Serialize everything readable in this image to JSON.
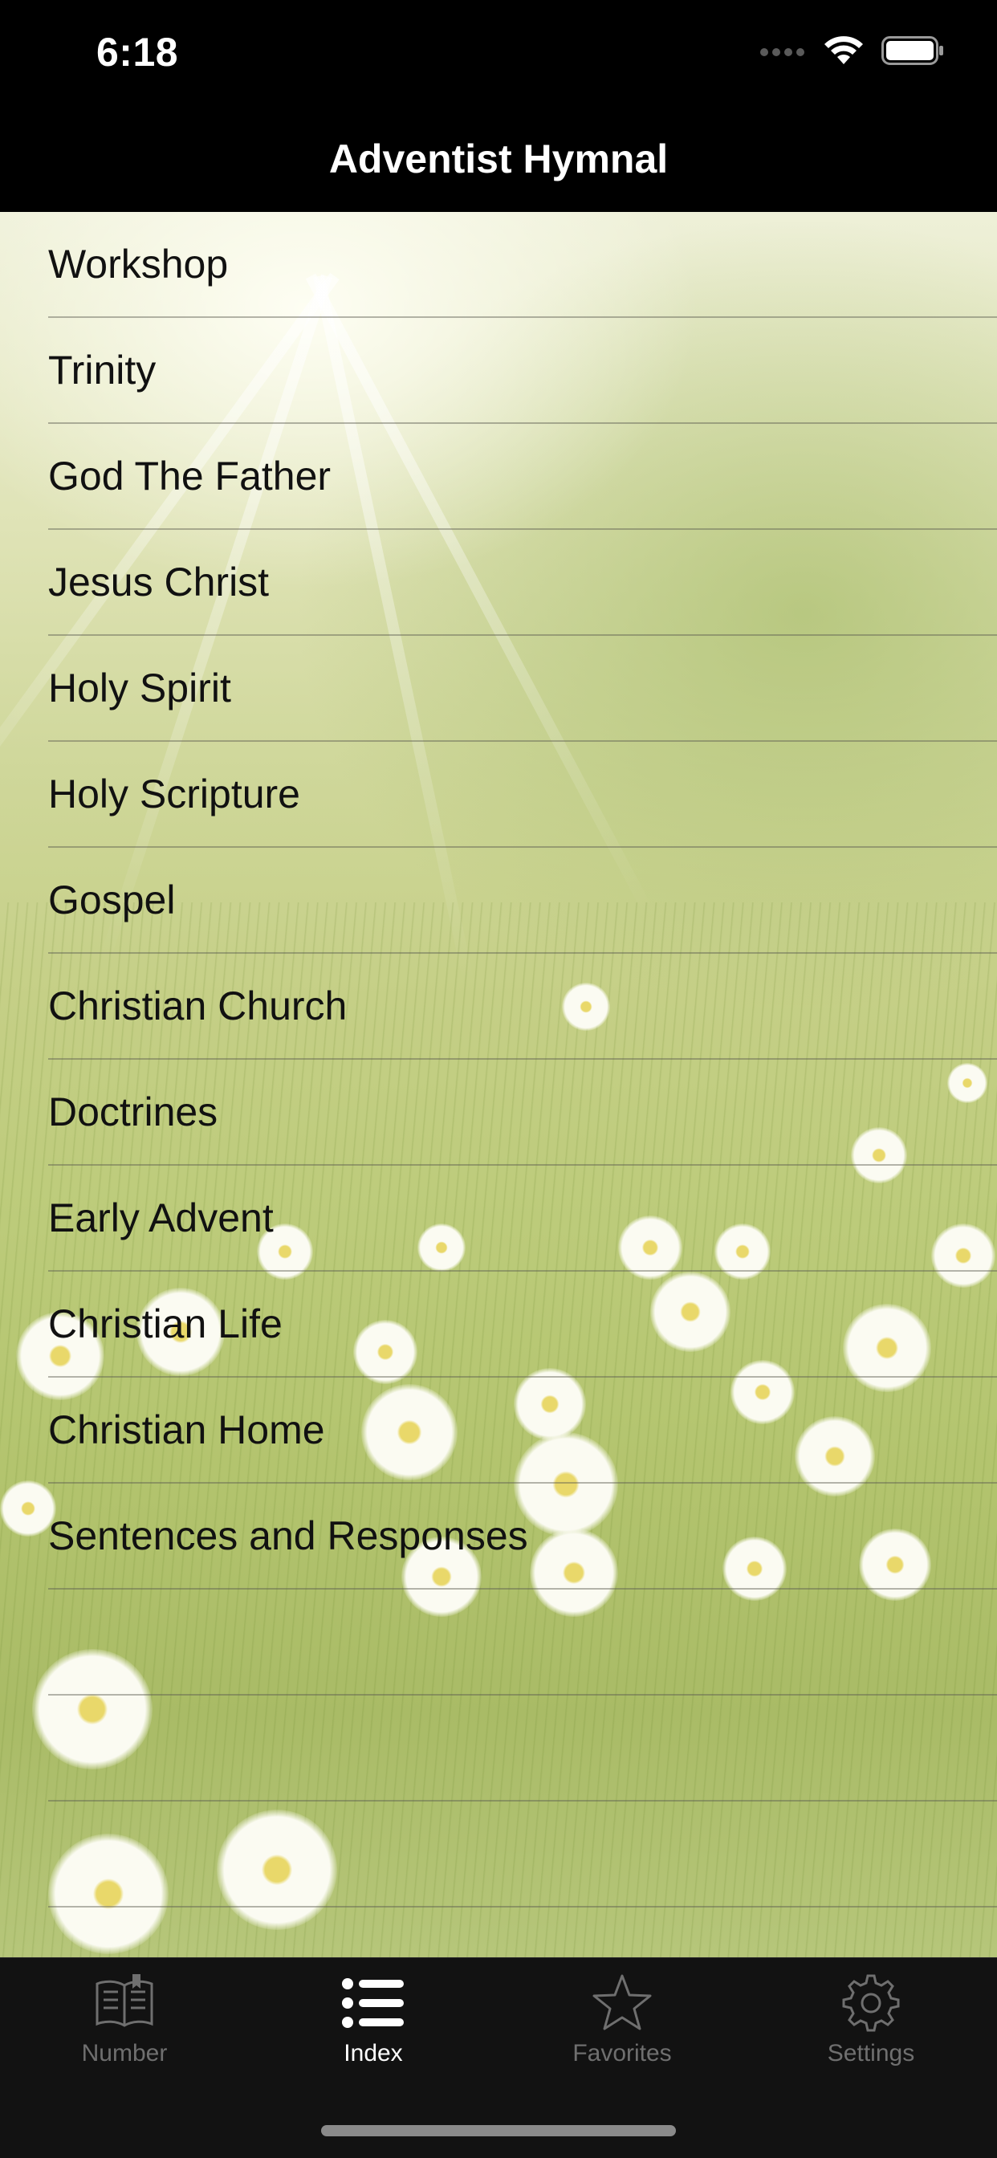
{
  "status_bar": {
    "time": "6:18"
  },
  "nav": {
    "title": "Adventist Hymnal"
  },
  "index": {
    "items": [
      "Workshop",
      "Trinity",
      "God The Father",
      "Jesus Christ",
      "Holy Spirit",
      "Holy Scripture",
      "Gospel",
      "Christian Church",
      "Doctrines",
      "Early Advent",
      "Christian Life",
      "Christian Home",
      "Sentences and Responses",
      "",
      "",
      ""
    ]
  },
  "tab_bar": {
    "tabs": [
      {
        "label": "Number",
        "icon": "book-icon",
        "active": false
      },
      {
        "label": "Index",
        "icon": "list-icon",
        "active": true
      },
      {
        "label": "Favorites",
        "icon": "star-icon",
        "active": false
      },
      {
        "label": "Settings",
        "icon": "gear-icon",
        "active": false
      }
    ]
  },
  "colors": {
    "bar_background": "#000000",
    "tab_bar_background": "#121212",
    "tab_inactive": "#6f6f6f",
    "tab_active": "#ffffff",
    "row_text": "#111111"
  }
}
